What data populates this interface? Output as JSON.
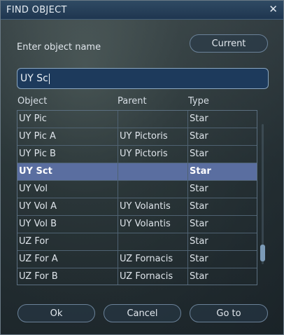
{
  "window": {
    "title": "FIND OBJECT",
    "close_glyph": "✕"
  },
  "prompt": "Enter object name",
  "current_button": "Current",
  "search": {
    "value": "UY Sc"
  },
  "columns": [
    "Object",
    "Parent",
    "Type"
  ],
  "rows": [
    {
      "object": "UY Pic",
      "parent": "",
      "type": "Star",
      "selected": false
    },
    {
      "object": "UY Pic A",
      "parent": "UY Pictoris",
      "type": "Star",
      "selected": false
    },
    {
      "object": "UY Pic B",
      "parent": "UY Pictoris",
      "type": "Star",
      "selected": false
    },
    {
      "object": "UY Sct",
      "parent": "",
      "type": "Star",
      "selected": true
    },
    {
      "object": "UY Vol",
      "parent": "",
      "type": "Star",
      "selected": false
    },
    {
      "object": "UY Vol A",
      "parent": "UY Volantis",
      "type": "Star",
      "selected": false
    },
    {
      "object": "UY Vol B",
      "parent": "UY Volantis",
      "type": "Star",
      "selected": false
    },
    {
      "object": "UZ For",
      "parent": "",
      "type": "Star",
      "selected": false
    },
    {
      "object": "UZ For A",
      "parent": "UZ Fornacis",
      "type": "Star",
      "selected": false
    },
    {
      "object": "UZ For B",
      "parent": "UZ Fornacis",
      "type": "Star",
      "selected": false
    }
  ],
  "buttons": {
    "ok": "Ok",
    "cancel": "Cancel",
    "goto": "Go to"
  },
  "colors": {
    "selection": "#5a6ea0",
    "titlebar": "#2f4a63",
    "search_bg": "#1d3a5c"
  }
}
